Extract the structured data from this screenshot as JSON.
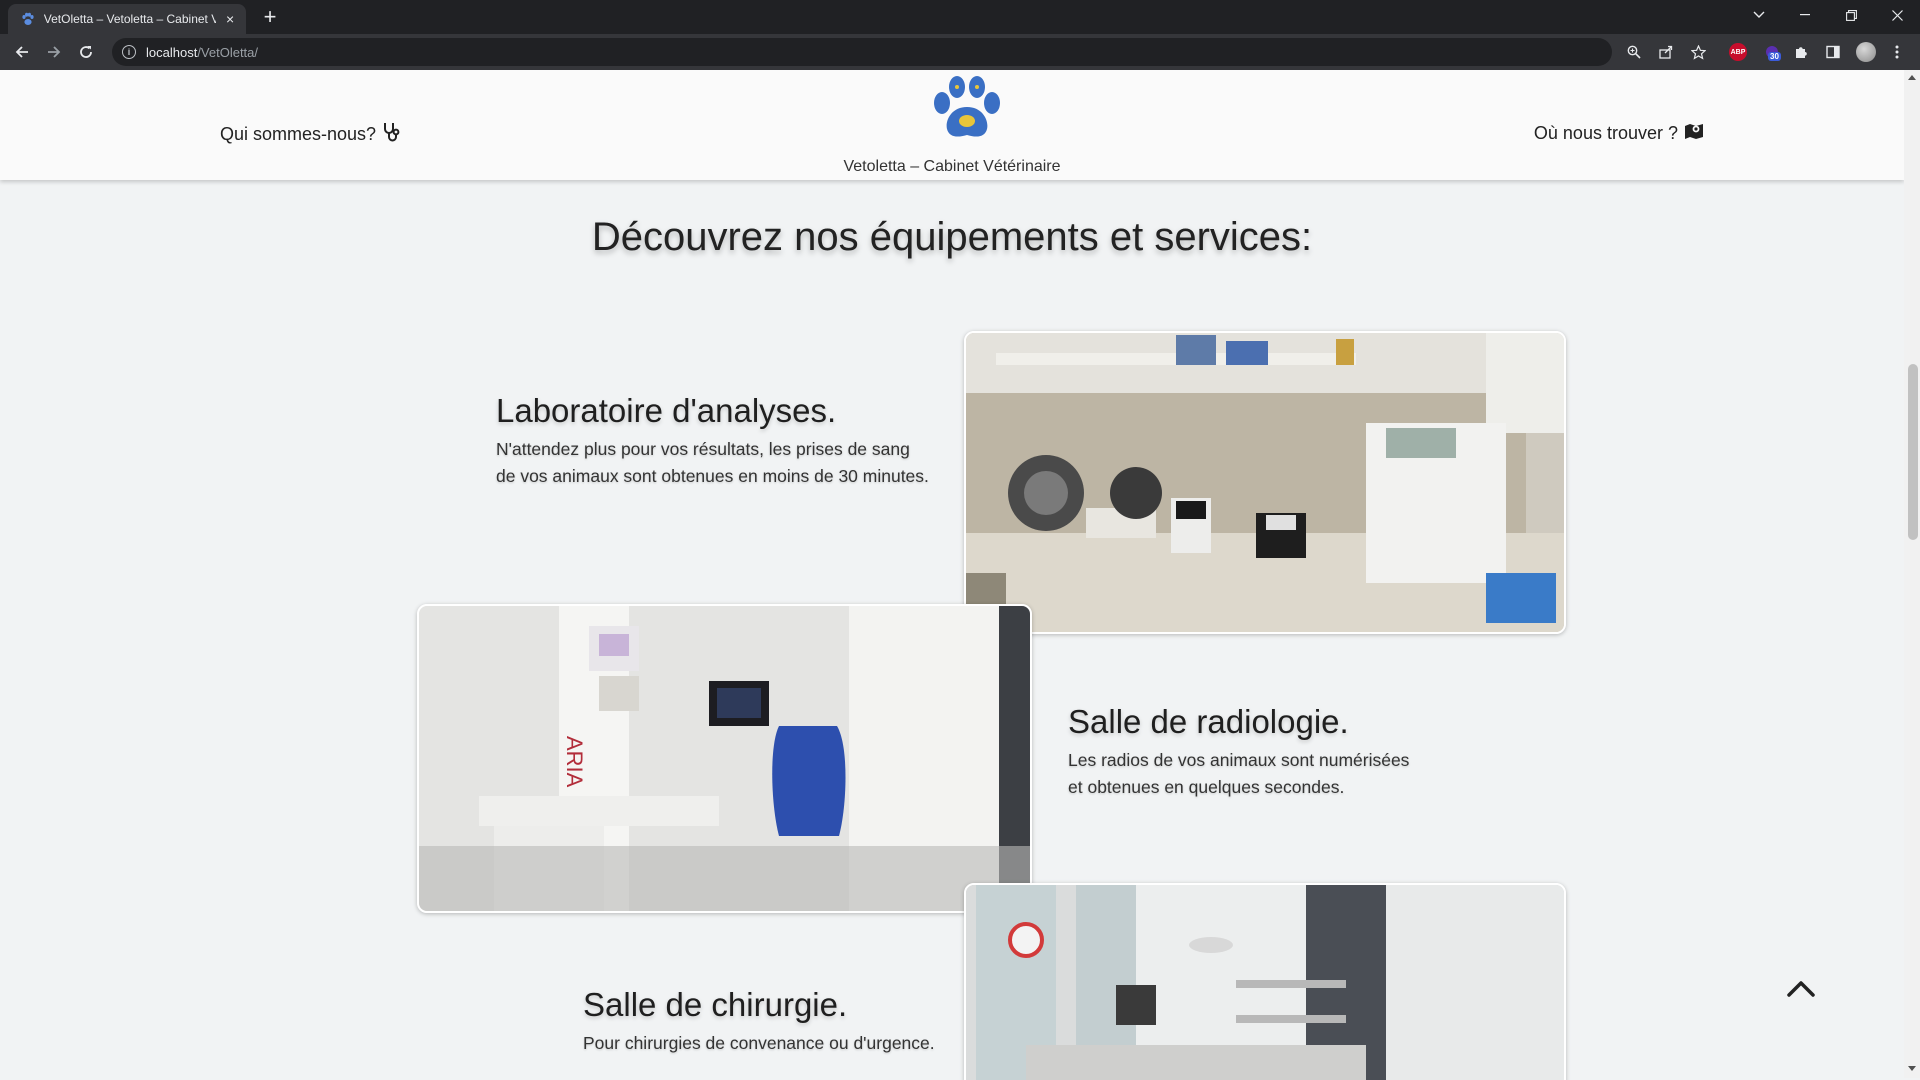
{
  "browser": {
    "tab_title": "VetOletta – Vetoletta – Cabinet V",
    "tab_close": "×",
    "new_tab": "+",
    "url_host": "localhost",
    "url_path": "/VetOletta/",
    "extension_badge": "30",
    "abp_label": "ABP",
    "icons": [
      "paw-favicon",
      "back-arrow",
      "forward-arrow",
      "reload",
      "info",
      "zoom",
      "share",
      "star",
      "adblock",
      "extension",
      "puzzle",
      "sidepanel",
      "profile",
      "menu"
    ]
  },
  "header": {
    "nav_left": "Qui sommes-nous?",
    "nav_right": "Où nous trouver ?",
    "brand": "Vetoletta – Cabinet Vétérinaire"
  },
  "section": {
    "title": "Découvrez nos équipements et services:"
  },
  "services": [
    {
      "title": "Laboratoire d'analyses.",
      "text_line1": "N'attendez plus pour vos résultats, les prises de sang",
      "text_line2": "de vos animaux sont obtenues en moins de 30 minutes."
    },
    {
      "title": "Salle de radiologie.",
      "text_line1": "Les radios de vos animaux sont numérisées",
      "text_line2": "et obtenues en quelques secondes."
    },
    {
      "title": "Salle de chirurgie.",
      "text_line1": "Pour chirurgies de convenance ou d'urgence."
    }
  ],
  "colors": {
    "paw_blue": "#3a6fc4",
    "paw_yellow": "#e8c53a",
    "chrome_dark": "#202124",
    "chrome_toolbar": "#35363a",
    "page_bg": "#f1f3f4"
  }
}
